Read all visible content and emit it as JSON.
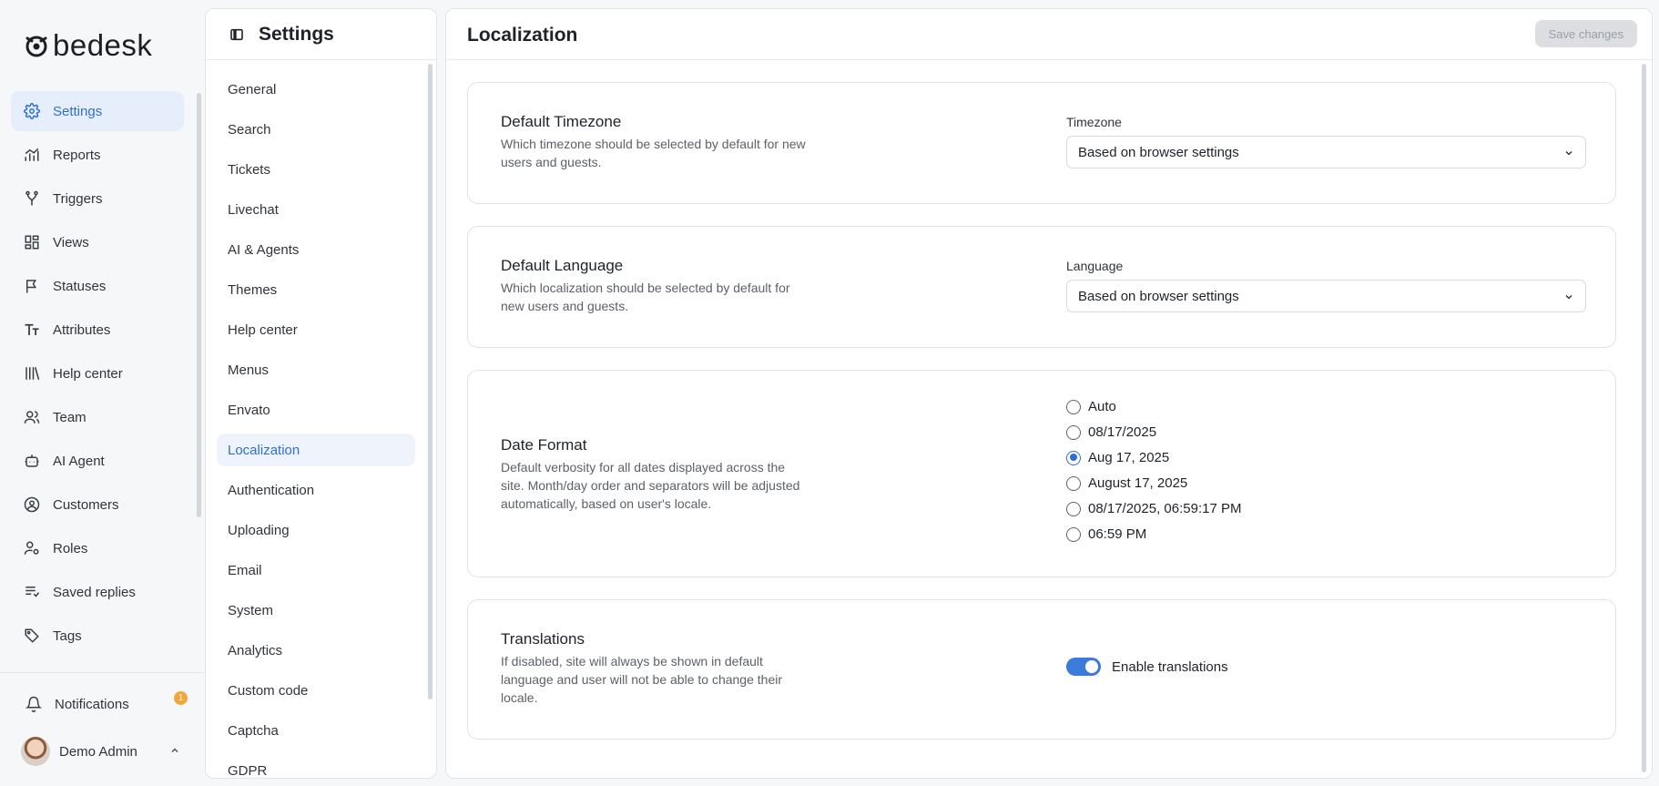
{
  "brand": {
    "name": "bedesk"
  },
  "nav": {
    "items": [
      {
        "label": "Settings",
        "icon": "gear-icon",
        "active": true
      },
      {
        "label": "Reports",
        "icon": "chart-icon"
      },
      {
        "label": "Triggers",
        "icon": "branch-icon"
      },
      {
        "label": "Views",
        "icon": "layout-icon"
      },
      {
        "label": "Statuses",
        "icon": "flag-icon"
      },
      {
        "label": "Attributes",
        "icon": "text-size-icon"
      },
      {
        "label": "Help center",
        "icon": "library-icon"
      },
      {
        "label": "Team",
        "icon": "users-icon"
      },
      {
        "label": "AI Agent",
        "icon": "bot-icon"
      },
      {
        "label": "Customers",
        "icon": "user-circle-icon"
      },
      {
        "label": "Roles",
        "icon": "user-cog-icon"
      },
      {
        "label": "Saved replies",
        "icon": "list-icon"
      },
      {
        "label": "Tags",
        "icon": "tag-icon"
      }
    ],
    "notifications": {
      "label": "Notifications",
      "count": "1"
    },
    "user": {
      "name": "Demo Admin"
    }
  },
  "settings_panel": {
    "title": "Settings",
    "items": [
      "General",
      "Search",
      "Tickets",
      "Livechat",
      "AI & Agents",
      "Themes",
      "Help center",
      "Menus",
      "Envato",
      "Localization",
      "Authentication",
      "Uploading",
      "Email",
      "System",
      "Analytics",
      "Custom code",
      "Captcha",
      "GDPR"
    ],
    "active": "Localization"
  },
  "main": {
    "title": "Localization",
    "save_label": "Save changes",
    "timezone": {
      "title": "Default Timezone",
      "description": "Which timezone should be selected by default for new users and guests.",
      "label": "Timezone",
      "value": "Based on browser settings"
    },
    "language": {
      "title": "Default Language",
      "description": "Which localization should be selected by default for new users and guests.",
      "label": "Language",
      "value": "Based on browser settings"
    },
    "date_format": {
      "title": "Date Format",
      "description": "Default verbosity for all dates displayed across the site. Month/day order and separators will be adjusted automatically, based on user's locale.",
      "options": [
        "Auto",
        "08/17/2025",
        "Aug 17, 2025",
        "August 17, 2025",
        "08/17/2025, 06:59:17 PM",
        "06:59 PM"
      ],
      "selected": "Aug 17, 2025"
    },
    "translations": {
      "title": "Translations",
      "description": "If disabled, site will always be shown in default language and user will not be able to change their locale.",
      "toggle_label": "Enable translations",
      "enabled": true
    }
  },
  "colors": {
    "accent": "#2d6fd6",
    "badge": "#f3a536"
  }
}
